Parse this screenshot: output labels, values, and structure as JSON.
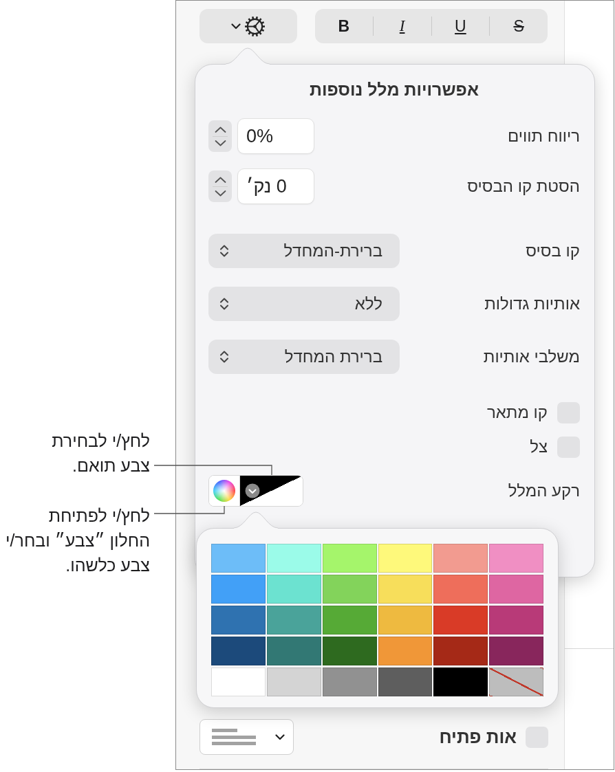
{
  "toolbar": {
    "format_buttons": [
      {
        "label": "S",
        "kind": "strikethrough"
      },
      {
        "label": "U",
        "kind": "underline"
      },
      {
        "label": "I",
        "kind": "italic"
      },
      {
        "label": "B",
        "kind": "bold"
      }
    ]
  },
  "options_popover": {
    "title": "אפשרויות מלל נוספות",
    "steppers": [
      {
        "label": "ריווח תווים",
        "value": "0%"
      },
      {
        "label": "הסטת קו הבסיס",
        "value": "0 נק׳"
      }
    ],
    "popups": [
      {
        "label": "קו בסיס",
        "value": "ברירת-המחדל"
      },
      {
        "label": "אותיות גדולות",
        "value": "ללא"
      },
      {
        "label": "משלבי אותיות",
        "value": "ברירת המחדל"
      }
    ],
    "checkboxes": [
      {
        "label": "קו מתאר",
        "checked": false
      },
      {
        "label": "צל",
        "checked": false
      }
    ],
    "text_background": {
      "label": "רקע המלל"
    }
  },
  "color_palette": {
    "swatches": [
      {
        "kind": "color",
        "color": "#6dbdf8"
      },
      {
        "kind": "color",
        "color": "#9bfbe9"
      },
      {
        "kind": "color",
        "color": "#a5f56b"
      },
      {
        "kind": "color",
        "color": "#fef97b"
      },
      {
        "kind": "color",
        "color": "#f29b90"
      },
      {
        "kind": "color",
        "color": "#f08fc3"
      },
      {
        "kind": "color",
        "color": "#42a0f7"
      },
      {
        "kind": "color",
        "color": "#6ce2d0"
      },
      {
        "kind": "color",
        "color": "#83d35b"
      },
      {
        "kind": "color",
        "color": "#f7de5b"
      },
      {
        "kind": "color",
        "color": "#ee6e5b"
      },
      {
        "kind": "color",
        "color": "#de66a2"
      },
      {
        "kind": "color",
        "color": "#2f72b0"
      },
      {
        "kind": "color",
        "color": "#4aa39a"
      },
      {
        "kind": "color",
        "color": "#56aa36"
      },
      {
        "kind": "color",
        "color": "#eeba40"
      },
      {
        "kind": "color",
        "color": "#d93b27"
      },
      {
        "kind": "color",
        "color": "#b83a78"
      },
      {
        "kind": "color",
        "color": "#1c4a7b"
      },
      {
        "kind": "color",
        "color": "#327874"
      },
      {
        "kind": "color",
        "color": "#2e6a1f"
      },
      {
        "kind": "color",
        "color": "#f09738"
      },
      {
        "kind": "color",
        "color": "#a52917"
      },
      {
        "kind": "color",
        "color": "#88265c"
      },
      {
        "kind": "color",
        "color": "#ffffff"
      },
      {
        "kind": "color",
        "color": "#d4d4d4"
      },
      {
        "kind": "color",
        "color": "#919191"
      },
      {
        "kind": "color",
        "color": "#5e5e5e"
      },
      {
        "kind": "color",
        "color": "#000000"
      },
      {
        "kind": "none"
      }
    ]
  },
  "drop_cap": {
    "label": "אות פתיח",
    "checked": false
  },
  "callouts": [
    {
      "text": "לחץ/י לבחירת\nצבע תואם."
    },
    {
      "text": "לחץ/י לפתיחת\nהחלון ״צבע״ ובחר/י\nצבע כלשהו."
    }
  ]
}
